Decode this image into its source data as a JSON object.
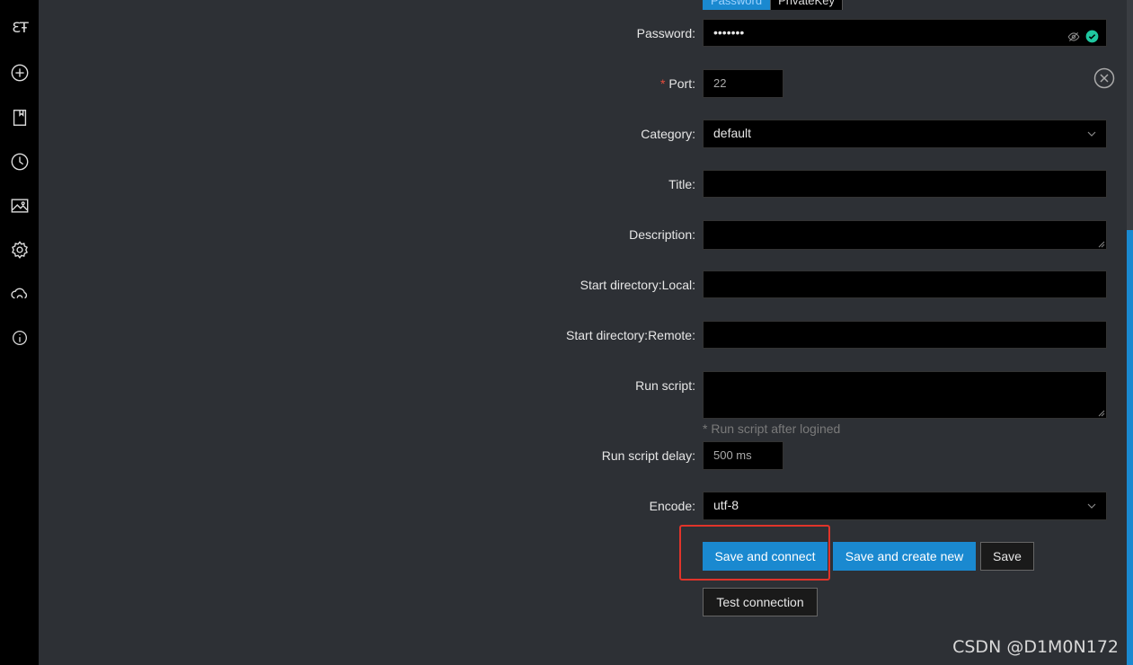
{
  "sidebar": {
    "logo": "ƐŦ",
    "icons": [
      "plus-circle-icon",
      "bookmark-icon",
      "history-icon",
      "image-icon",
      "gear-icon",
      "cloud-sync-icon",
      "info-icon"
    ]
  },
  "auth_tabs": {
    "password": "Password",
    "private_key": "PrivateKey"
  },
  "form": {
    "password": {
      "label": "Password",
      "value": "•••••••"
    },
    "port": {
      "label": "Port",
      "value": "22"
    },
    "category": {
      "label": "Category",
      "value": "default"
    },
    "title": {
      "label": "Title",
      "value": ""
    },
    "description": {
      "label": "Description",
      "value": ""
    },
    "start_local": {
      "label": "Start directory:Local",
      "value": ""
    },
    "start_remote": {
      "label": "Start directory:Remote",
      "value": ""
    },
    "run_script": {
      "label": "Run script",
      "value": "",
      "hint": "* Run script after logined"
    },
    "run_script_delay": {
      "label": "Run script delay",
      "value": "500 ms"
    },
    "encode": {
      "label": "Encode",
      "value": "utf-8"
    }
  },
  "buttons": {
    "save_and_connect": "Save and connect",
    "save_and_create_new": "Save and create new",
    "save": "Save",
    "test_connection": "Test connection"
  },
  "watermark": "CSDN @D1M0N172",
  "colors": {
    "accent": "#1a89d0",
    "success": "#1fc7a0",
    "required": "#e74c3c",
    "highlight": "#e0342a"
  }
}
